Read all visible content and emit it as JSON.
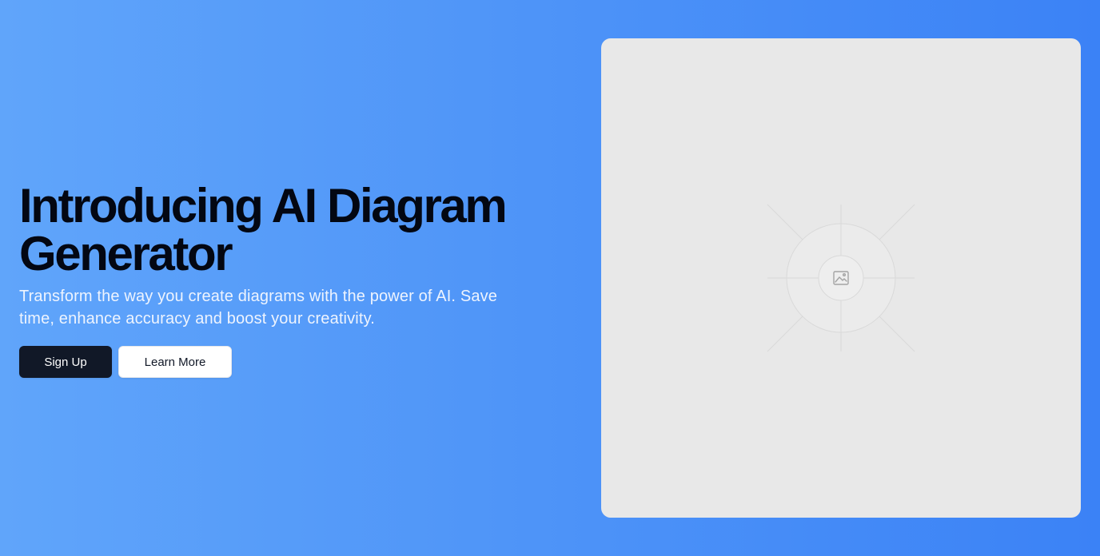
{
  "hero": {
    "title": "Introducing AI Diagram Generator",
    "subtitle": "Transform the way you create diagrams with the power of AI. Save time, enhance accuracy and boost your creativity.",
    "primary_button_label": "Sign Up",
    "secondary_button_label": "Learn More"
  },
  "media": {
    "icon": "image-icon"
  },
  "colors": {
    "background_start": "#60a5fa",
    "background_end": "#3b82f6",
    "title": "#030712",
    "primary_button": "#111827",
    "secondary_button": "#ffffff",
    "placeholder": "#e8e8e8"
  }
}
